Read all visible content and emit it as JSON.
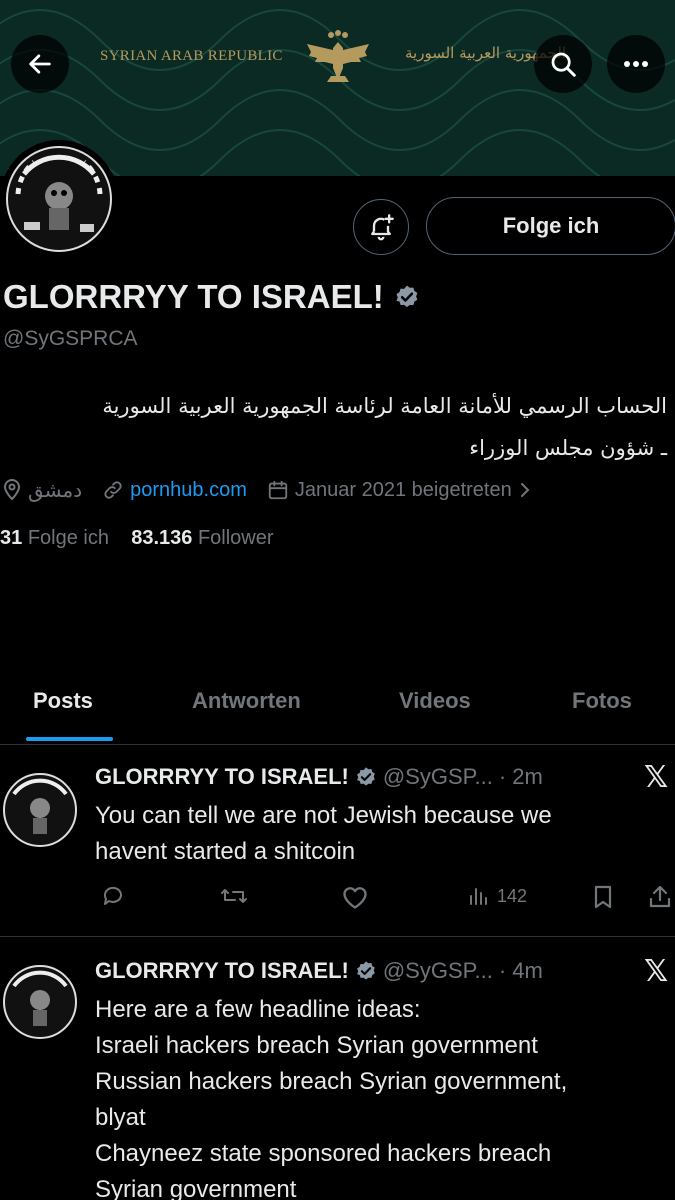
{
  "banner": {
    "text_en": "SYRIAN ARAB REPUBLIC",
    "text_ar": "الجمهورية العربية السورية"
  },
  "profile": {
    "follow_label": "Folge ich",
    "display_name": "GLORRRYY TO ISRAEL!",
    "handle": "@SyGSPRCA",
    "bio_line1": "الحساب الرسمي للأمانة العامة لرئاسة الجمهورية العربية السورية",
    "bio_line2": "ـ شؤون مجلس الوزراء",
    "location": "دمشق",
    "link": "pornhub.com",
    "joined": "Januar 2021 beigetreten",
    "following_count": "31",
    "following_label": "Folge ich",
    "followers_count": "83.136",
    "followers_label": "Follower"
  },
  "tabs": [
    {
      "label": "Posts"
    },
    {
      "label": "Antworten"
    },
    {
      "label": "Videos"
    },
    {
      "label": "Fotos"
    }
  ],
  "posts": [
    {
      "name": "GLORRRYY TO ISRAEL!",
      "handle": "@SyGSP...",
      "time": "· 2m",
      "lines": [
        "You can tell we are not Jewish because we",
        "havent started a shitcoin"
      ],
      "views": "142"
    },
    {
      "name": "GLORRRYY TO ISRAEL!",
      "handle": "@SyGSP...",
      "time": "· 4m",
      "lines": [
        "Here are a few headline ideas:",
        "Israeli hackers breach Syrian government",
        "Russian hackers breach Syrian government,",
        "blyat",
        "Chayneez state sponsored hackers breach",
        "Syrian government"
      ]
    }
  ],
  "colors": {
    "accent": "#1d9bf0",
    "banner": "#0b2a24",
    "muted": "#71767b"
  }
}
